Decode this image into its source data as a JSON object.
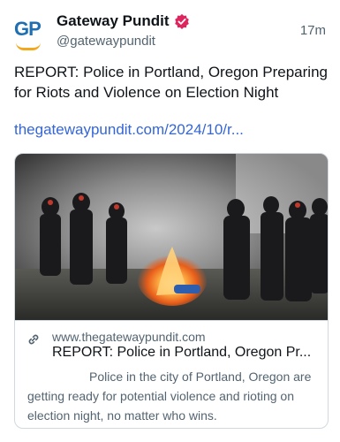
{
  "account": {
    "avatar_text": "GP",
    "name": "Gateway Pundit",
    "handle": "@gatewaypundit",
    "time": "17m",
    "verified_badge_icon": "verified-badge-icon",
    "badge_color": "#e0245e"
  },
  "post": {
    "text": "REPORT: Police in Portland, Oregon Preparing for Riots and Violence on Election Night",
    "link": "thegatewaypundit.com/2024/10/r..."
  },
  "card": {
    "image_icon": "riot-police-fire-photo",
    "link_icon": "link-icon",
    "domain": "www.thegatewaypundit.com",
    "title": "REPORT: Police in Portland, Oregon Pr...",
    "description": "Police in the city of Portland, Oregon are getting ready for potential violence and rioting on election night, no matter who wins."
  },
  "colors": {
    "link": "#3466d6",
    "secondary_text": "#536471",
    "gp_blue": "#1f6fb2",
    "gp_gold": "#f2a81d"
  }
}
